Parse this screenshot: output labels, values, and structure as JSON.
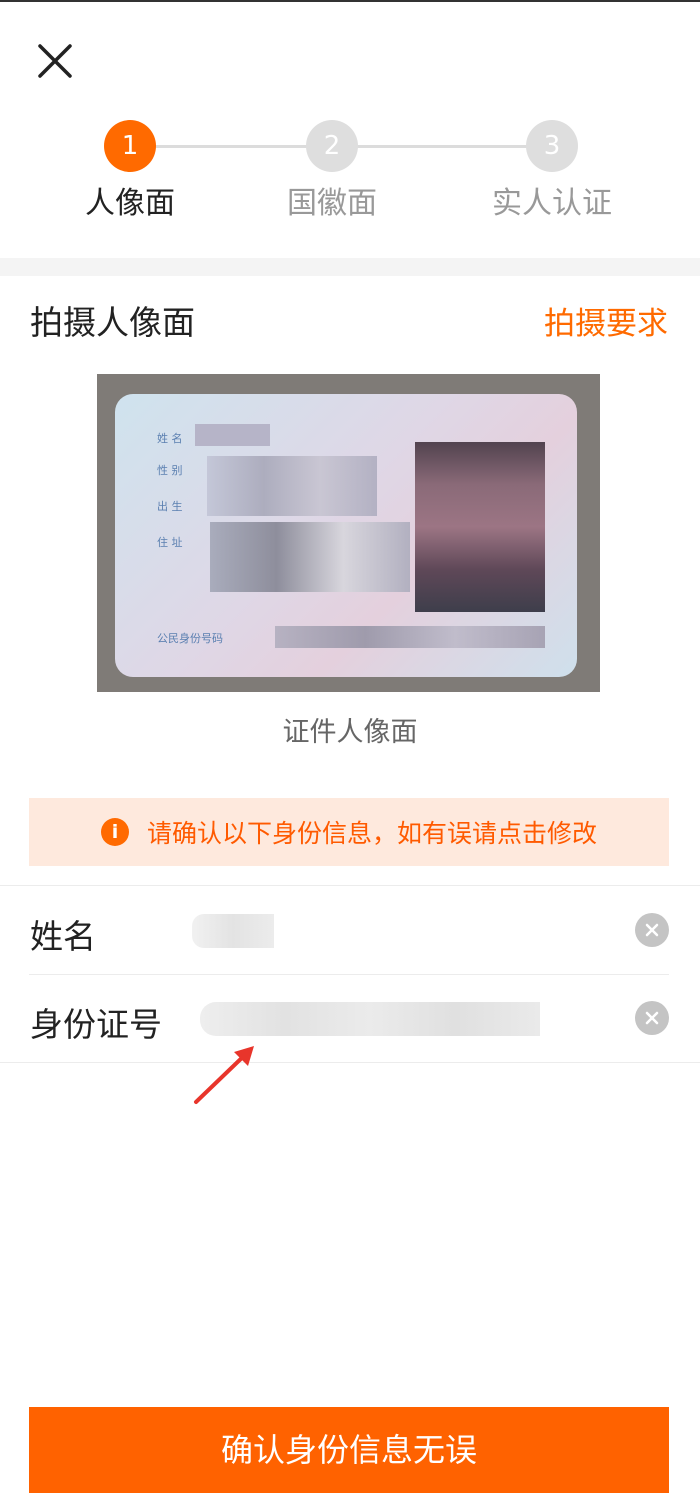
{
  "steps": [
    {
      "number": "1",
      "label": "人像面",
      "active": true
    },
    {
      "number": "2",
      "label": "国徽面",
      "active": false
    },
    {
      "number": "3",
      "label": "实人认证",
      "active": false
    }
  ],
  "section": {
    "title": "拍摄人像面",
    "link": "拍摄要求"
  },
  "card_labels": {
    "name": "姓 名",
    "gender": "性 别",
    "birth": "出 生",
    "address": "住 址",
    "id_number": "公民身份号码"
  },
  "photo_caption": "证件人像面",
  "notice": {
    "icon": "i",
    "text": "请确认以下身份信息，如有误请点击修改"
  },
  "fields": {
    "name_label": "姓名",
    "id_label": "身份证号"
  },
  "confirm_button": "确认身份信息无误",
  "colors": {
    "accent": "#ff6a00",
    "notice_bg": "#fee9dd",
    "inactive_step": "#dedede"
  },
  "icons": {
    "close": "close-icon",
    "info": "info-icon",
    "clear": "clear-icon",
    "arrow": "red-arrow-annotation"
  }
}
